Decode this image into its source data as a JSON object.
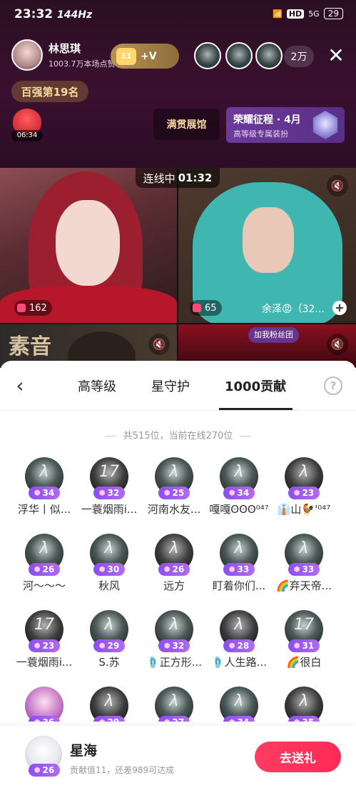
{
  "status_bar": {
    "time": "23:32",
    "refresh_rate": "144Hz",
    "hd": "HD",
    "network": "5G",
    "battery": "29"
  },
  "host": {
    "name": "林思琪",
    "likes": "1003.7万本场点赞",
    "fan_level": "11",
    "plus_v": "+V"
  },
  "viewers": {
    "count": "2万"
  },
  "rank": "百强第19名",
  "gift_bag_timer": "06:34",
  "hall_button": "满贯展馆",
  "glory": {
    "title": "荣耀征程 · 4月",
    "subtitle": "高等级专属装扮"
  },
  "link": {
    "label": "连线中",
    "time": "01:32"
  },
  "streams": {
    "left_score": "162",
    "right_score": "65",
    "guest_name": "余泽😡（32...",
    "cam3_text": "素音",
    "fanclub_tag": "加我粉丝团"
  },
  "tabs": [
    {
      "label": "高等级"
    },
    {
      "label": "星守护"
    },
    {
      "label": "1000贡献"
    }
  ],
  "count_text": "共515位，当前在线270位",
  "members": [
    {
      "name": "浮华丨似...",
      "level": "34",
      "glyph": "λ"
    },
    {
      "name": "一蓑烟雨i...",
      "level": "32",
      "glyph": "17"
    },
    {
      "name": "河南水友...",
      "level": "25",
      "glyph": "λ"
    },
    {
      "name": "嘎嘎ʘʘʘ⁰⁴⁷",
      "level": "34",
      "glyph": "λ"
    },
    {
      "name": "👔山🐓'⁰⁴⁷",
      "level": "23",
      "glyph": "λ"
    },
    {
      "name": "河～～～",
      "level": "26",
      "glyph": "λ"
    },
    {
      "name": "秋风",
      "level": "30",
      "glyph": "λ"
    },
    {
      "name": "远方",
      "level": "26",
      "glyph": "λ"
    },
    {
      "name": "盯着你们...",
      "level": "33",
      "glyph": "λ"
    },
    {
      "name": "🌈弃天帝...",
      "level": "33",
      "glyph": "λ"
    },
    {
      "name": "一蓑烟雨i...",
      "level": "23",
      "glyph": "17"
    },
    {
      "name": "S.苏",
      "level": "29",
      "glyph": "λ"
    },
    {
      "name": "🩴正方形...",
      "level": "32",
      "glyph": "λ"
    },
    {
      "name": "🩴人生路...",
      "level": "28",
      "glyph": "λ"
    },
    {
      "name": "🌈很白",
      "level": "31",
      "glyph": "17"
    },
    {
      "name": "",
      "level": "36",
      "glyph": ""
    },
    {
      "name": "",
      "level": "29",
      "glyph": "λ"
    },
    {
      "name": "",
      "level": "27",
      "glyph": "λ"
    },
    {
      "name": "",
      "level": "34",
      "glyph": "λ"
    },
    {
      "name": "",
      "level": "35",
      "glyph": "λ"
    }
  ],
  "me": {
    "name": "星海",
    "level": "26",
    "progress": "贡献值11，还差989可达成"
  },
  "send_button": "去送礼",
  "icons": {
    "back": "chevron-left-icon",
    "help": "question-icon",
    "close": "close-icon",
    "mute": "mute-icon"
  },
  "colors": {
    "accent": "#ff2a55",
    "badge": "#8a4ff0",
    "top_bg": "#3a1030"
  }
}
